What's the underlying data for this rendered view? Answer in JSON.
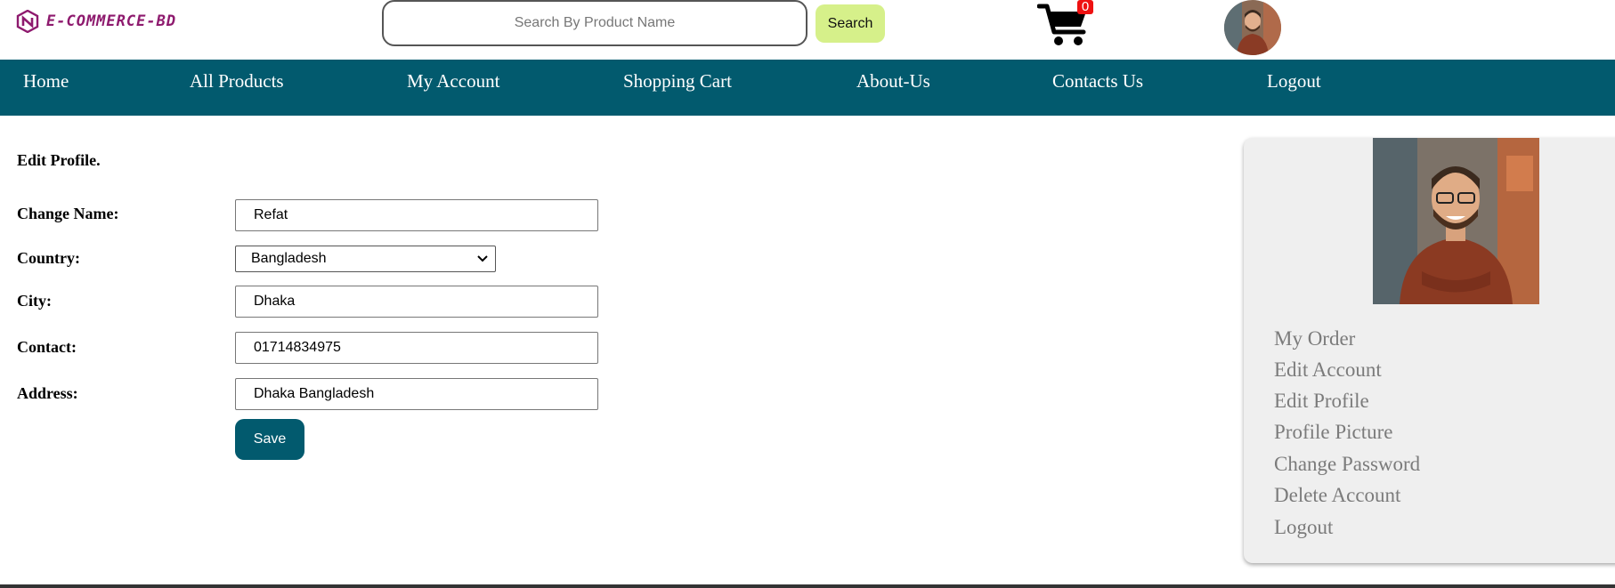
{
  "brand": {
    "name": "E-COMMERCE-BD"
  },
  "search": {
    "placeholder": "Search By Product Name",
    "button_label": "Search"
  },
  "cart": {
    "count": "0"
  },
  "nav": {
    "items": [
      {
        "label": "Home"
      },
      {
        "label": "All Products"
      },
      {
        "label": "My Account"
      },
      {
        "label": "Shopping Cart"
      },
      {
        "label": "About-Us"
      },
      {
        "label": "Contacts Us"
      },
      {
        "label": "Logout"
      }
    ]
  },
  "form": {
    "title": "Edit Profile.",
    "name_label": "Change Name:",
    "name_value": "Refat",
    "country_label": "Country:",
    "country_value": "Bangladesh",
    "city_label": "City:",
    "city_value": "Dhaka",
    "contact_label": "Contact:",
    "contact_value": "01714834975",
    "address_label": "Address:",
    "address_value": "Dhaka Bangladesh",
    "save_label": "Save"
  },
  "sidebar": {
    "links": [
      {
        "label": "My Order"
      },
      {
        "label": "Edit Account"
      },
      {
        "label": "Edit Profile"
      },
      {
        "label": "Profile Picture"
      },
      {
        "label": "Change Password"
      },
      {
        "label": "Delete Account"
      },
      {
        "label": "Logout"
      }
    ]
  },
  "colors": {
    "nav_bg": "#025a6e",
    "search_button_bg": "#d6f08a",
    "brand_text": "#8e1a6e",
    "cart_badge": "#ee1111",
    "sidebar_bg": "#efefef",
    "sidebar_link": "#7b7b7b"
  }
}
